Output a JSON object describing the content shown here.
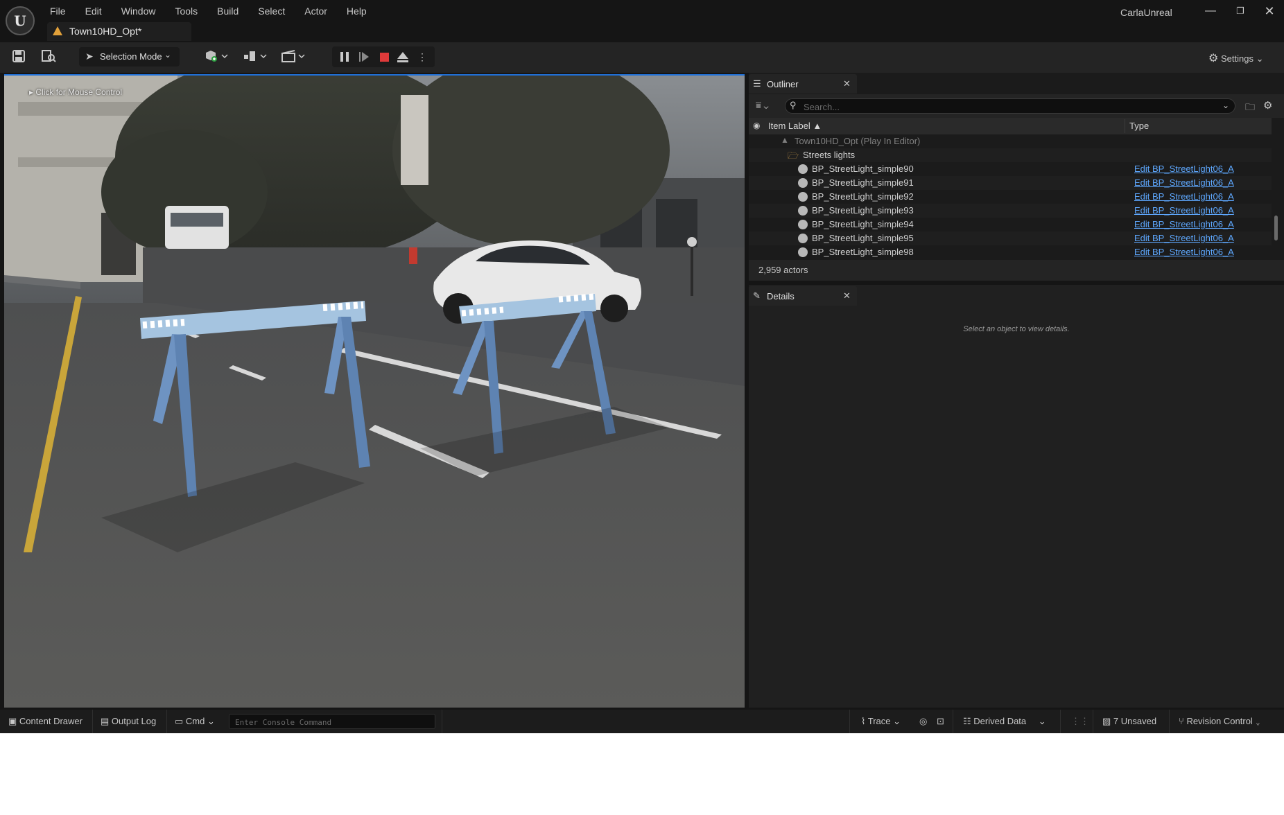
{
  "menu": [
    "File",
    "Edit",
    "Window",
    "Tools",
    "Build",
    "Select",
    "Actor",
    "Help"
  ],
  "level_tab": "Town10HD_Opt*",
  "project_name": "CarlaUnreal",
  "toolbar": {
    "selection_mode": "Selection Mode",
    "settings": "Settings"
  },
  "viewport": {
    "mouse_control_hint": "Click for Mouse Control"
  },
  "outliner": {
    "tab_label": "Outliner",
    "search_placeholder": "Search...",
    "col_label": "Item Label ▲",
    "col_type": "Type",
    "world_row": "Town10HD_Opt (Play In Editor)",
    "folder_row": "Streets lights",
    "rows": [
      {
        "label": "BP_StreetLight_simple90",
        "type": "Edit BP_StreetLight06_A"
      },
      {
        "label": "BP_StreetLight_simple91",
        "type": "Edit BP_StreetLight06_A"
      },
      {
        "label": "BP_StreetLight_simple92",
        "type": "Edit BP_StreetLight06_A"
      },
      {
        "label": "BP_StreetLight_simple93",
        "type": "Edit BP_StreetLight06_A"
      },
      {
        "label": "BP_StreetLight_simple94",
        "type": "Edit BP_StreetLight06_A"
      },
      {
        "label": "BP_StreetLight_simple95",
        "type": "Edit BP_StreetLight06_A"
      },
      {
        "label": "BP_StreetLight_simple98",
        "type": "Edit BP_StreetLight06_A"
      }
    ],
    "actor_count": "2,959 actors"
  },
  "details": {
    "tab_label": "Details",
    "empty_message": "Select an object to view details."
  },
  "statusbar": {
    "content_drawer": "Content Drawer",
    "output_log": "Output Log",
    "cmd": "Cmd",
    "console_placeholder": "Enter Console Command",
    "trace": "Trace",
    "derived_data": "Derived Data",
    "unsaved": "7 Unsaved",
    "revision_control": "Revision Control"
  },
  "icons": {
    "save": "save-icon",
    "browse": "browse-icon",
    "add": "add-actor-icon",
    "snap": "snap-icon",
    "cinematic": "cinematic-icon",
    "pause": "pause-icon",
    "step": "step-icon",
    "stop": "stop-icon",
    "eject": "eject-icon"
  },
  "colors": {
    "accent_blue": "#1f6fd6",
    "link_blue": "#5ea8ff",
    "stop_red": "#e03a3a",
    "warning_orange": "#e2a13a"
  }
}
